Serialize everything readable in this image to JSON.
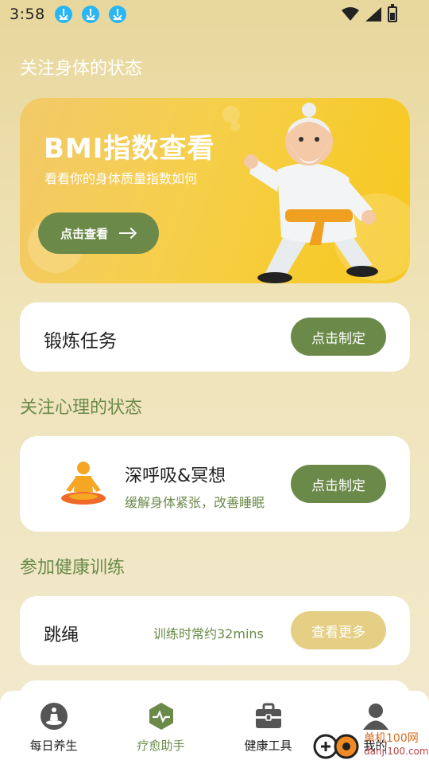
{
  "status_bar": {
    "time": "3:58",
    "notification_icons": [
      "download-icon",
      "download-icon",
      "download-icon"
    ]
  },
  "sections": {
    "body": "关注身体的状态",
    "mind": "关注心理的状态",
    "training": "参加健康训练"
  },
  "banner": {
    "title": "BMI指数查看",
    "subtitle": "看看你的身体质量指数如何",
    "button_label": "点击查看"
  },
  "task_card": {
    "label": "锻炼任务",
    "button_label": "点击制定"
  },
  "breath_card": {
    "title": "深呼吸&冥想",
    "subtitle": "缓解身体紧张，改善睡眠",
    "button_label": "点击制定"
  },
  "rope_card": {
    "name": "跳绳",
    "duration": "训练时常约32mins",
    "button_label": "查看更多"
  },
  "tabbar": {
    "items": [
      {
        "label": "每日养生",
        "icon": "meditation-icon",
        "active": false
      },
      {
        "label": "疗愈助手",
        "icon": "pulse-icon",
        "active": true
      },
      {
        "label": "健康工具",
        "icon": "toolbox-icon",
        "active": false
      },
      {
        "label": "我的",
        "icon": "person-icon",
        "active": false
      }
    ]
  },
  "watermark": {
    "line1": "单机100网",
    "line2": "danji100.com"
  },
  "colors": {
    "accent_green": "#6b8a4a",
    "beige_button": "#e5cf85",
    "banner_yellow": "#f6cf4a"
  }
}
